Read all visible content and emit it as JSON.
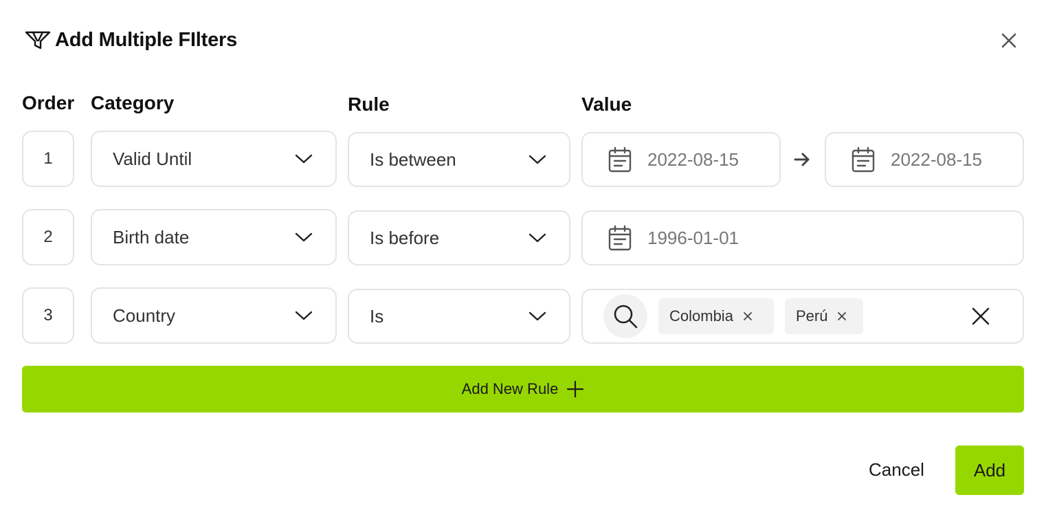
{
  "dialog": {
    "title": "Add Multiple FIlters",
    "icons": {
      "title": "filter-icon",
      "close": "close-icon"
    }
  },
  "columns": {
    "order": "Order",
    "category": "Category",
    "rule": "Rule",
    "value": "Value"
  },
  "rows": [
    {
      "order": "1",
      "category": "Valid Until",
      "rule": "Is between",
      "value_from": "2022-08-15",
      "value_to": "2022-08-15"
    },
    {
      "order": "2",
      "category": "Birth date",
      "rule": "Is before",
      "value": "1996-01-01"
    },
    {
      "order": "3",
      "category": "Country",
      "rule": "Is",
      "chips": [
        "Colombia",
        "Perú"
      ]
    }
  ],
  "add_rule_label": "Add New Rule",
  "footer": {
    "cancel": "Cancel",
    "add": "Add"
  },
  "colors": {
    "accent": "#97d700",
    "border": "#e4e4e4",
    "chip_bg": "#f2f2f2"
  }
}
